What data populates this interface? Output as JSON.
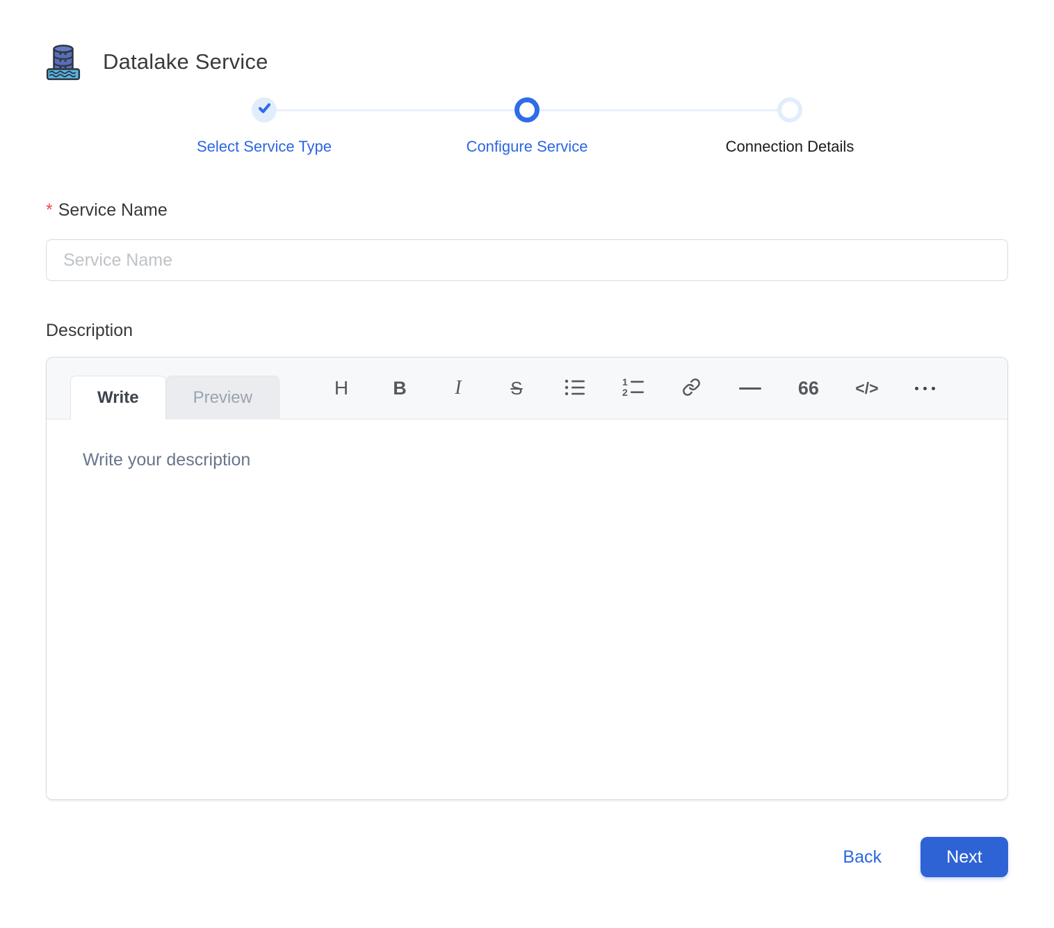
{
  "header": {
    "title": "Datalake Service"
  },
  "stepper": {
    "steps": [
      {
        "label": "Select Service Type",
        "state": "completed"
      },
      {
        "label": "Configure Service",
        "state": "active"
      },
      {
        "label": "Connection Details",
        "state": "pending"
      }
    ]
  },
  "form": {
    "service_name": {
      "required_marker": "*",
      "label": "Service Name",
      "placeholder": "Service Name",
      "value": ""
    },
    "description": {
      "label": "Description",
      "editor": {
        "tabs": [
          {
            "label": "Write",
            "active": true
          },
          {
            "label": "Preview",
            "active": false
          }
        ],
        "toolbar": [
          {
            "name": "heading",
            "glyph": "H"
          },
          {
            "name": "bold",
            "glyph": "B"
          },
          {
            "name": "italic",
            "glyph": "I"
          },
          {
            "name": "strikethrough",
            "glyph": "S"
          },
          {
            "name": "bullet-list",
            "glyph": ""
          },
          {
            "name": "ordered-list",
            "glyph": ""
          },
          {
            "name": "link",
            "glyph": ""
          },
          {
            "name": "horizontal-rule",
            "glyph": "—"
          },
          {
            "name": "quote",
            "glyph": "66"
          },
          {
            "name": "code",
            "glyph": "</>"
          },
          {
            "name": "more",
            "glyph": "•••"
          }
        ],
        "placeholder": "Write your description",
        "value": ""
      }
    }
  },
  "footer": {
    "back_label": "Back",
    "next_label": "Next"
  },
  "colors": {
    "accent_blue": "#2b66e4",
    "button_blue": "#2e63d6",
    "step_ring_blue": "#2f6ce8",
    "step_light_blue": "#e2edfc",
    "connector_blue": "#e9f0fa",
    "required_red": "#ef4c45"
  }
}
